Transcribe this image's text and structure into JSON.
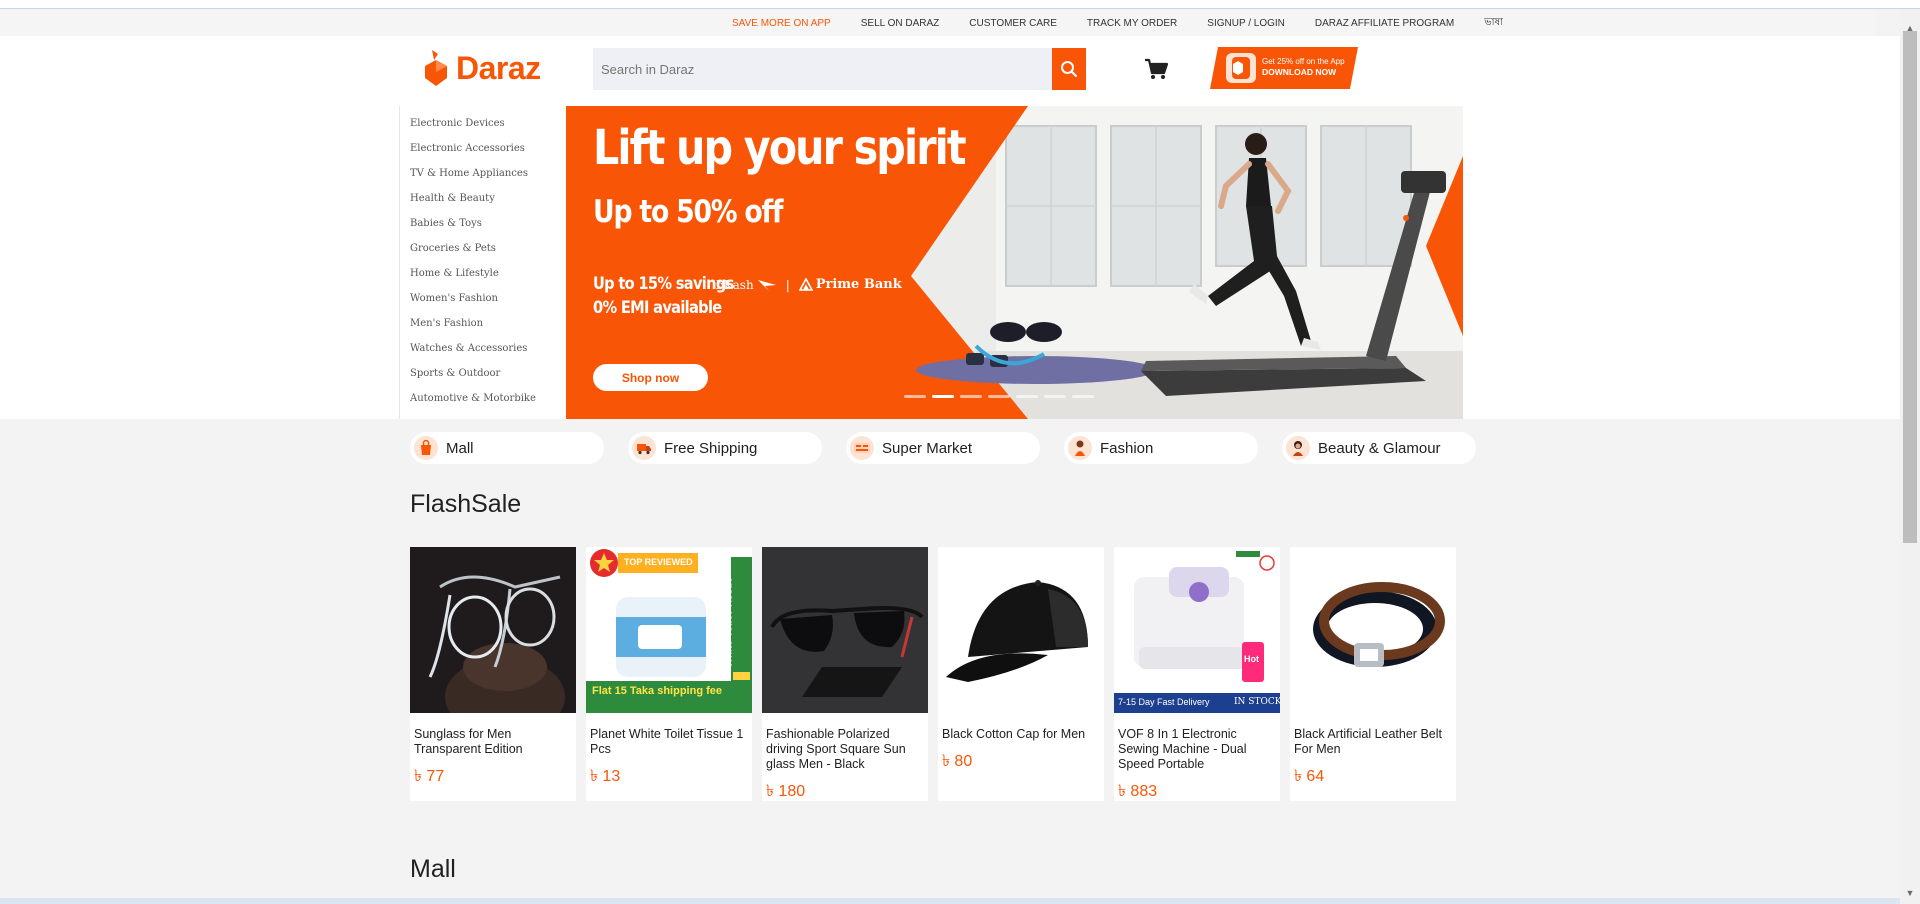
{
  "topbar": {
    "links": [
      "SAVE MORE ON APP",
      "SELL ON DARAZ",
      "CUSTOMER CARE",
      "TRACK MY ORDER",
      "SIGNUP / LOGIN",
      "DARAZ AFFILIATE PROGRAM",
      "ভাষা"
    ]
  },
  "header": {
    "logo_text": "Daraz",
    "search_placeholder": "Search in Daraz",
    "app_promo_line1": "Get 25% off on the App",
    "app_promo_line2": "DOWNLOAD NOW"
  },
  "categories": [
    "Electronic Devices",
    "Electronic Accessories",
    "TV & Home Appliances",
    "Health & Beauty",
    "Babies & Toys",
    "Groceries & Pets",
    "Home & Lifestyle",
    "Women's Fashion",
    "Men's Fashion",
    "Watches & Accessories",
    "Sports & Outdoor",
    "Automotive & Motorbike"
  ],
  "banner": {
    "headline": "Lift up your spirit",
    "subheadline": "Up to 50% off",
    "savings": "Up to 15% savings",
    "bkash": "bKash",
    "bank": "Prime Bank",
    "emi": "0% EMI available",
    "cta": "Shop now",
    "brand_color": "#f85606"
  },
  "pills": [
    {
      "label": "Mall",
      "icon": "mall-icon"
    },
    {
      "label": "Free Shipping",
      "icon": "truck-icon"
    },
    {
      "label": "Super Market",
      "icon": "supermarket-icon"
    },
    {
      "label": "Fashion",
      "icon": "fashion-icon"
    },
    {
      "label": "Beauty & Glamour",
      "icon": "beauty-icon"
    }
  ],
  "flashsale": {
    "title": "FlashSale",
    "products": [
      {
        "name": "Sunglass for Men Transparent Edition",
        "price": "৳ 77"
      },
      {
        "name": "Planet White Toilet Tissue 1 Pcs",
        "price": "৳ 13",
        "badge": "TOP REVIEWED",
        "image_text": "White Toilet Tissue",
        "image_banner": "Flat 15 Taka shipping fee"
      },
      {
        "name": "Fashionable Polarized driving Sport Square Sun glass Men - Black",
        "price": "৳ 180"
      },
      {
        "name": "Black Cotton Cap for Men",
        "price": "৳ 80"
      },
      {
        "name": "VOF 8 In 1 Electronic Sewing Machine - Dual Speed Portable",
        "price": "৳ 883",
        "image_banner": "7-15 Day Fast Delivery",
        "image_stock": "IN STOCK",
        "image_hot": "Hot"
      },
      {
        "name": "Black Artificial Leather Belt For Men",
        "price": "৳ 64"
      }
    ]
  },
  "mall": {
    "title": "Mall"
  }
}
